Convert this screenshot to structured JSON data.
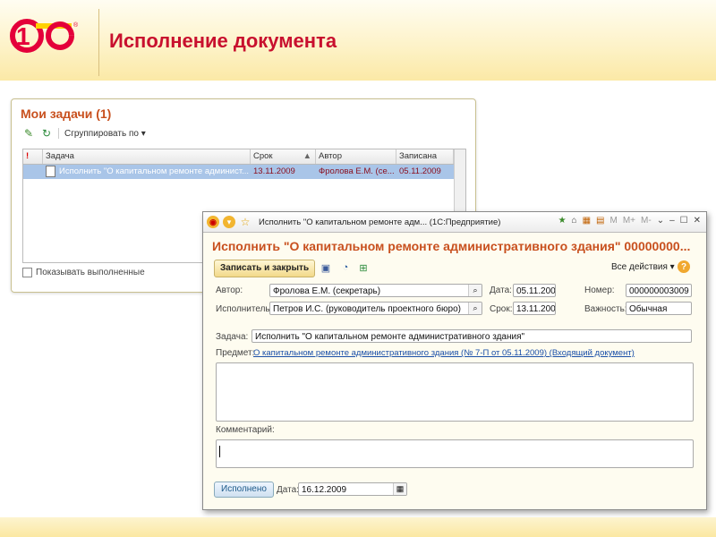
{
  "slide": {
    "title": "Исполнение документа",
    "logo_text": "1С"
  },
  "tasks": {
    "title": "Мои задачи (1)",
    "group_by": "Сгруппировать по",
    "columns": [
      "!",
      "Задача",
      "Срок",
      "Автор",
      "Записана"
    ],
    "rows": [
      {
        "task": "Исполнить \"О капитальном ремонте админист...",
        "due": "13.11.2009",
        "author": "Фролова Е.М. (се...",
        "recorded": "05.11.2009"
      }
    ],
    "show_done": "Показывать выполненные"
  },
  "form": {
    "window_title": "Исполнить \"О капитальном ремонте адм...  (1С:Предприятие)",
    "title": "Исполнить \"О капитальном ремонте административного здания\" 00000000...",
    "save_close": "Записать и закрыть",
    "all_actions": "Все действия",
    "labels": {
      "author": "Автор:",
      "date": "Дата:",
      "number": "Номер:",
      "executor": "Исполнитель:",
      "due": "Срок:",
      "importance": "Важность:",
      "task": "Задача:",
      "subject": "Предмет:",
      "comment": "Комментарий:",
      "done_date": "Дата:"
    },
    "values": {
      "author": "Фролова Е.М. (секретарь)",
      "date": "05.11.2009",
      "number": "000000003009",
      "executor": "Петров И.С. (руководитель проектного бюро)",
      "due": "13.11.2009",
      "importance": "Обычная",
      "task": "Исполнить \"О капитальном ремонте административного здания\"",
      "subject_link": "О капитальном ремонте административного здания (№ 7-П от 05.11.2009) (Входящий документ)",
      "done_date": "16.12.2009"
    },
    "done_button": "Исполнено",
    "toolbar_letters": {
      "m": "M",
      "mplus": "M+",
      "mminus": "M-"
    }
  },
  "colors": {
    "accent": "#c8102e",
    "form_title": "#c8501e",
    "selection": "#a9c5e8"
  }
}
